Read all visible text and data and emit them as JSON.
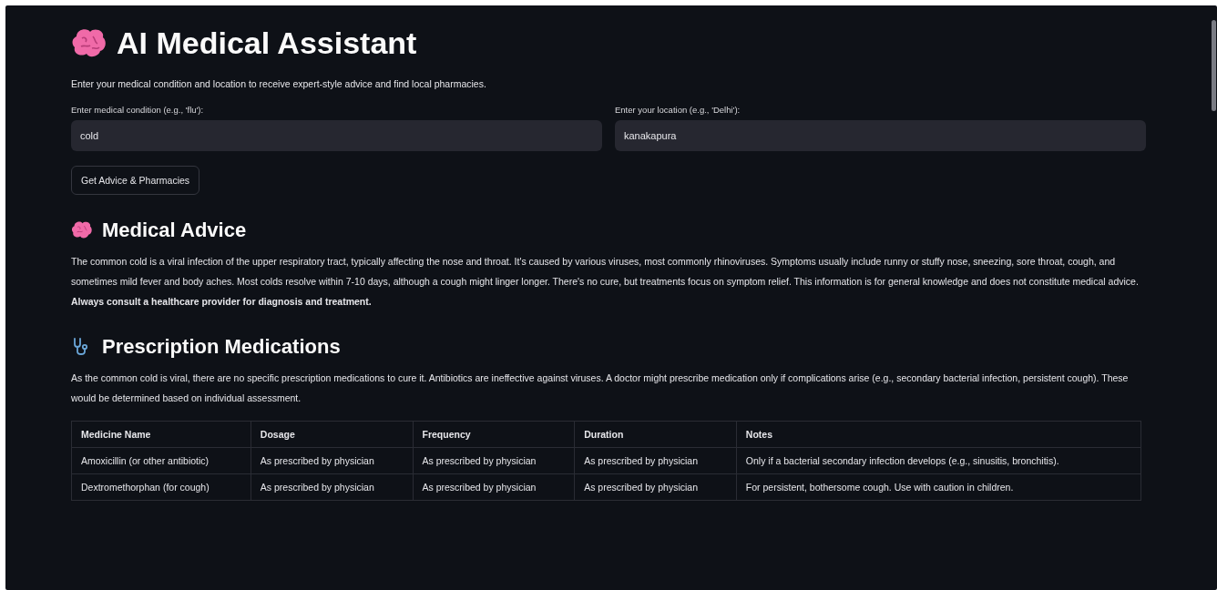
{
  "title": "AI Medical Assistant",
  "intro": "Enter your medical condition and location to receive expert-style advice and find local pharmacies.",
  "fields": [
    {
      "label": "Enter medical condition (e.g., 'flu'):",
      "value": "cold"
    },
    {
      "label": "Enter your location (e.g., 'Delhi'):",
      "value": "kanakapura"
    }
  ],
  "button": "Get Advice & Pharmacies",
  "advice": {
    "heading": "Medical Advice",
    "text": "The common cold is a viral infection of the upper respiratory tract, typically affecting the nose and throat. It's caused by various viruses, most commonly rhinoviruses. Symptoms usually include runny or stuffy nose, sneezing, sore throat, cough, and sometimes mild fever and body aches. Most colds resolve within 7-10 days, although a cough might linger longer. There's no cure, but treatments focus on symptom relief. This information is for general knowledge and does not constitute medical advice. **Always consult a healthcare provider for diagnosis and treatment.**"
  },
  "prescription": {
    "heading": "Prescription Medications",
    "text": "As the common cold is viral, there are no specific prescription medications to cure it. Antibiotics are ineffective against viruses. A doctor might prescribe medication only if complications arise (e.g., secondary bacterial infection, persistent cough). These would be determined based on individual assessment.",
    "table": {
      "columns": [
        "Medicine Name",
        "Dosage",
        "Frequency",
        "Duration",
        "Notes"
      ],
      "rows": [
        [
          "Amoxicillin (or other antibiotic)",
          "As prescribed by physician",
          "As prescribed by physician",
          "As prescribed by physician",
          "Only if a bacterial secondary infection develops (e.g., sinusitis, bronchitis)."
        ],
        [
          "Dextromethorphan (for cough)",
          "As prescribed by physician",
          "As prescribed by physician",
          "As prescribed by physician",
          "For persistent, bothersome cough. Use with caution in children."
        ]
      ]
    }
  }
}
